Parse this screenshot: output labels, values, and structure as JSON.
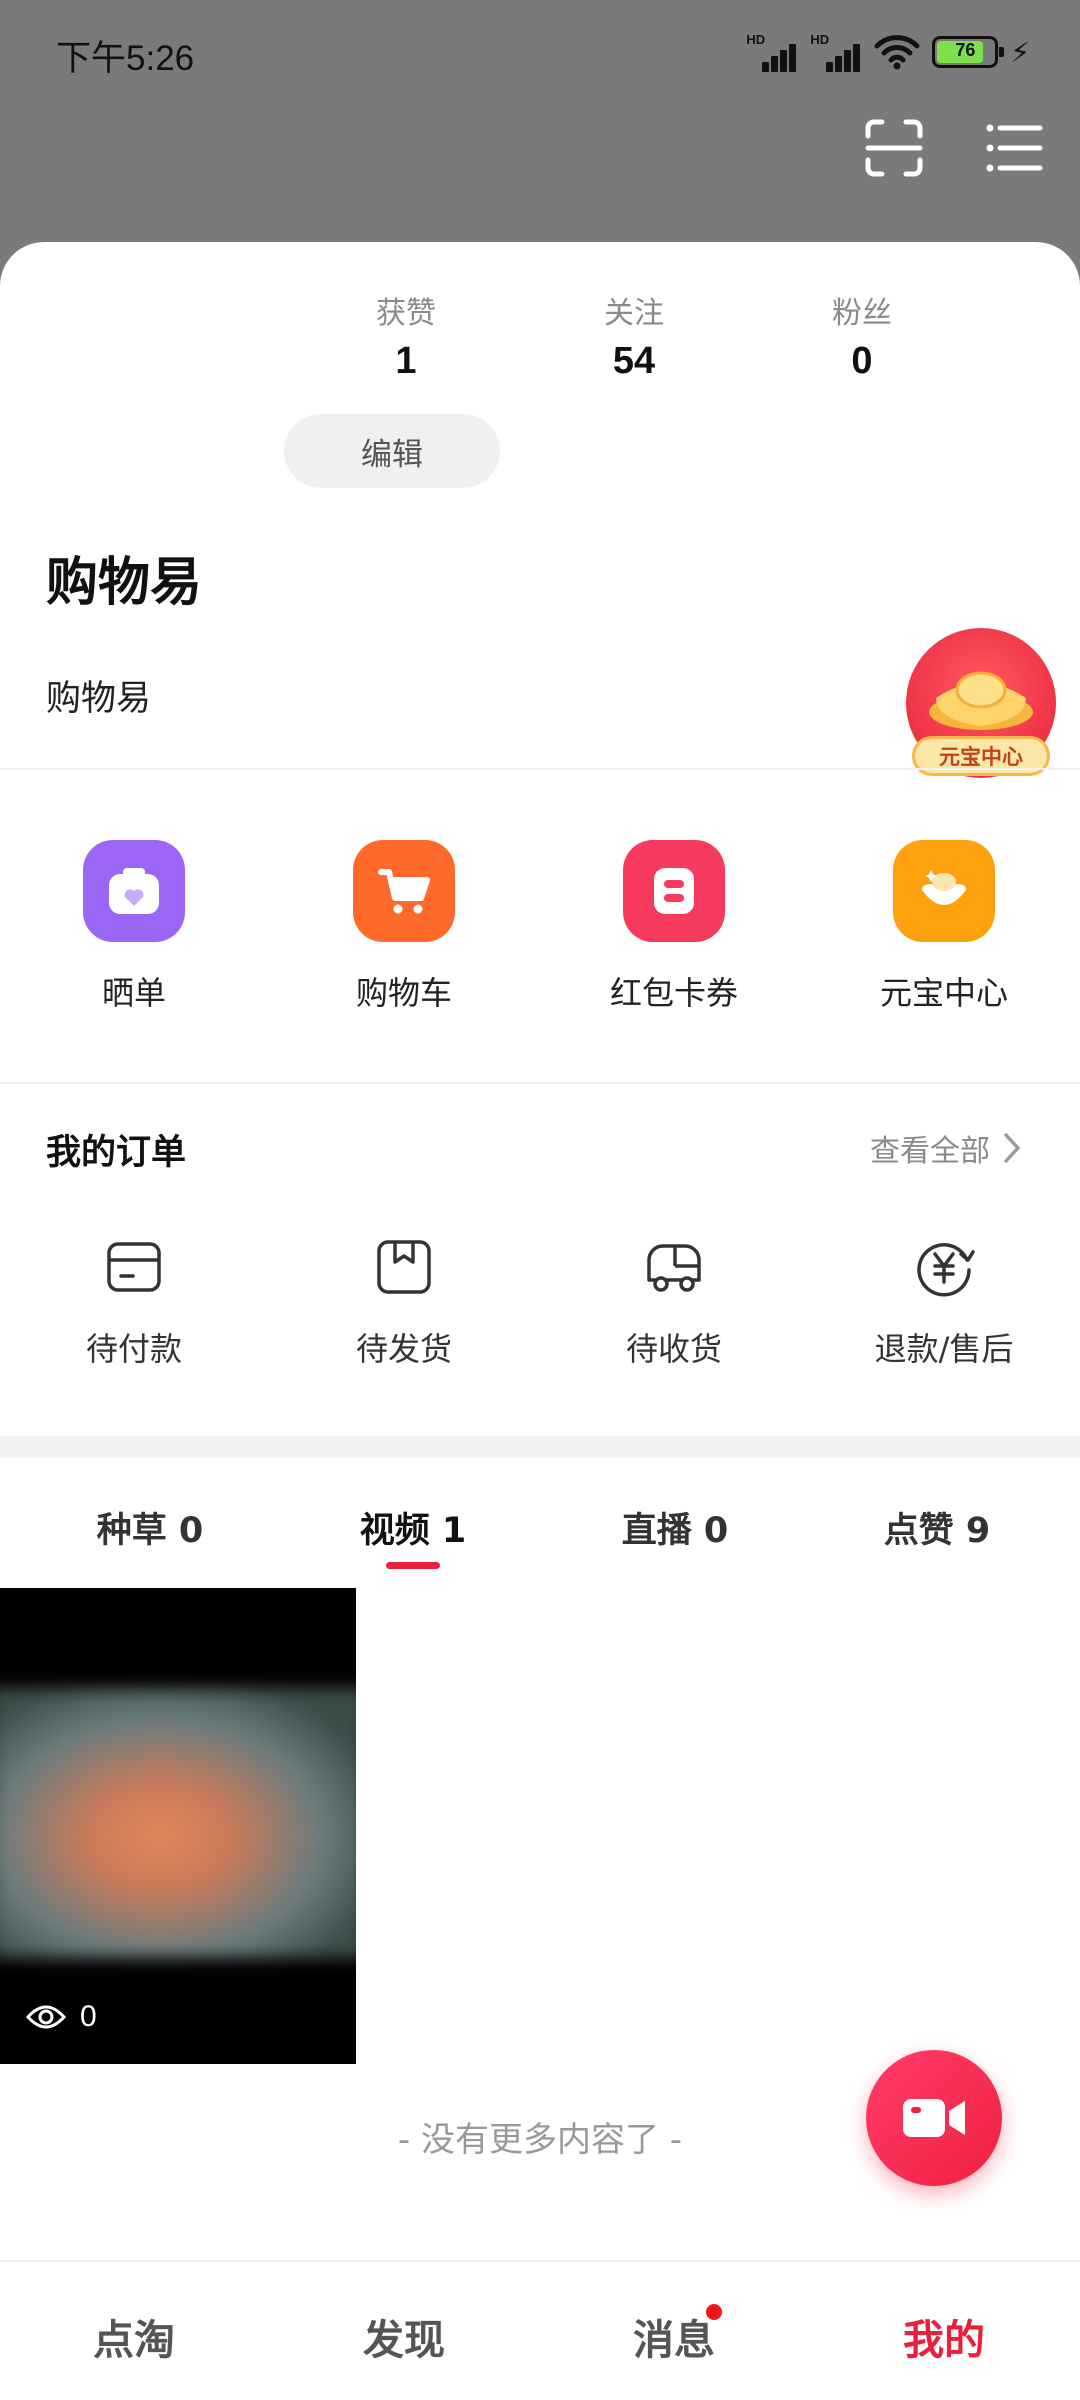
{
  "status_bar": {
    "time": "下午5:26",
    "signal_label_1": "HD",
    "signal_label_2": "HD",
    "battery": "76",
    "icons": [
      "signal-icon",
      "signal-icon",
      "wifi-icon",
      "battery-icon",
      "charging-icon"
    ]
  },
  "header_actions": {
    "icons": [
      "scan-icon",
      "menu-list-icon"
    ]
  },
  "stats": [
    {
      "label": "获赞",
      "value": "1"
    },
    {
      "label": "关注",
      "value": "54"
    },
    {
      "label": "粉丝",
      "value": "0"
    }
  ],
  "edit_label": "编辑",
  "profile": {
    "name": "购物易",
    "bio": "购物易"
  },
  "yuanbao_badge": "元宝中心",
  "shortcuts": [
    {
      "label": "晒单",
      "color": "#9b66f5",
      "icon": "showcase-icon"
    },
    {
      "label": "购物车",
      "color": "#ff6a2a",
      "icon": "cart-icon"
    },
    {
      "label": "红包卡券",
      "color": "#f53a5e",
      "icon": "coupon-icon"
    },
    {
      "label": "元宝中心",
      "color": "#ffa10f",
      "icon": "ingot-icon"
    }
  ],
  "orders": {
    "title": "我的订单",
    "view_all": "查看全部",
    "items": [
      {
        "label": "待付款",
        "icon": "wallet-icon"
      },
      {
        "label": "待发货",
        "icon": "package-icon"
      },
      {
        "label": "待收货",
        "icon": "truck-icon"
      },
      {
        "label": "退款/售后",
        "icon": "refund-icon"
      }
    ]
  },
  "content_tabs": [
    {
      "label": "种草 0"
    },
    {
      "label": "视频 1"
    },
    {
      "label": "直播 0"
    },
    {
      "label": "点赞 9"
    }
  ],
  "active_tab": "视频 1",
  "video": {
    "views": "0"
  },
  "no_more_text": "- 没有更多内容了 -",
  "bottom_nav": [
    {
      "label": "点淘"
    },
    {
      "label": "发现"
    },
    {
      "label": "消息"
    },
    {
      "label": "我的"
    }
  ],
  "accent_color": "#e8203e"
}
